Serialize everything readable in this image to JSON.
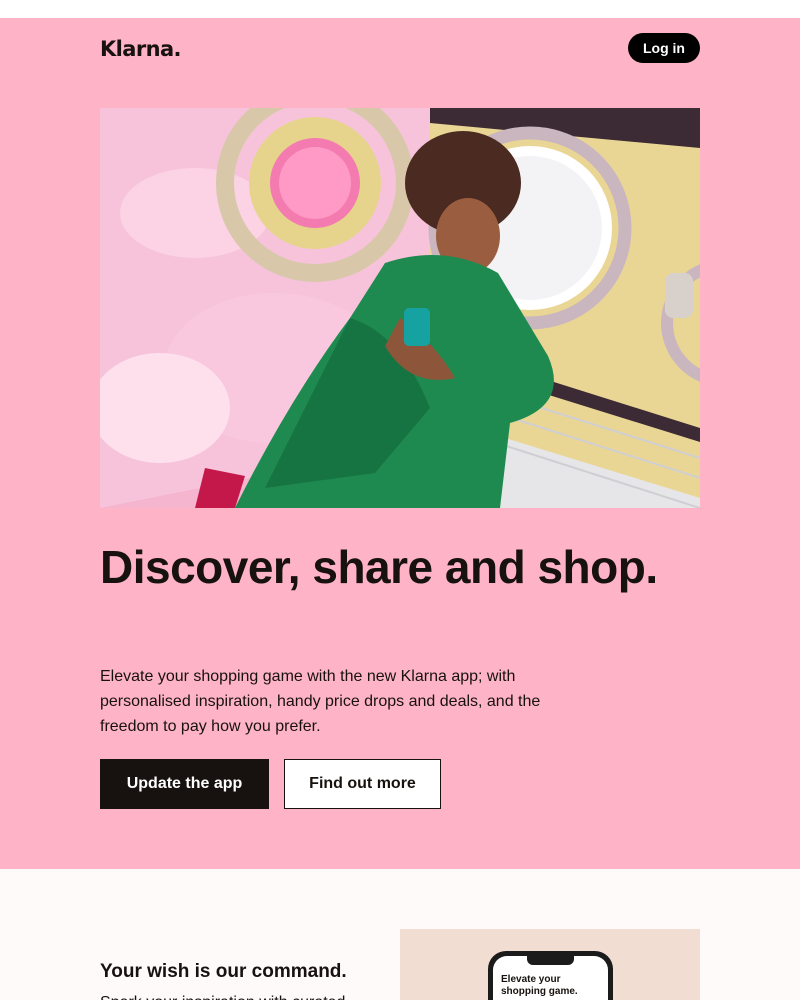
{
  "header": {
    "logo_text": "Klarna.",
    "login_label": "Log in"
  },
  "hero": {
    "image_description": "photo",
    "headline": "Discover, share and shop.",
    "body": "Elevate your shopping game with the new Klarna app; with personalised inspiration, handy price drops and deals, and the freedom to pay how you prefer.",
    "primary_cta": "Update the app",
    "secondary_cta": "Find out more"
  },
  "feature": {
    "title": "Your wish is our command.",
    "text": "Spark your inspiration with curated",
    "phone_screen_text": "Elevate your shopping game."
  },
  "colors": {
    "hero_background": "#ffb3c7",
    "primary_button": "#17120f",
    "text": "#17120f",
    "feature_image_background": "#f2ddd3"
  }
}
